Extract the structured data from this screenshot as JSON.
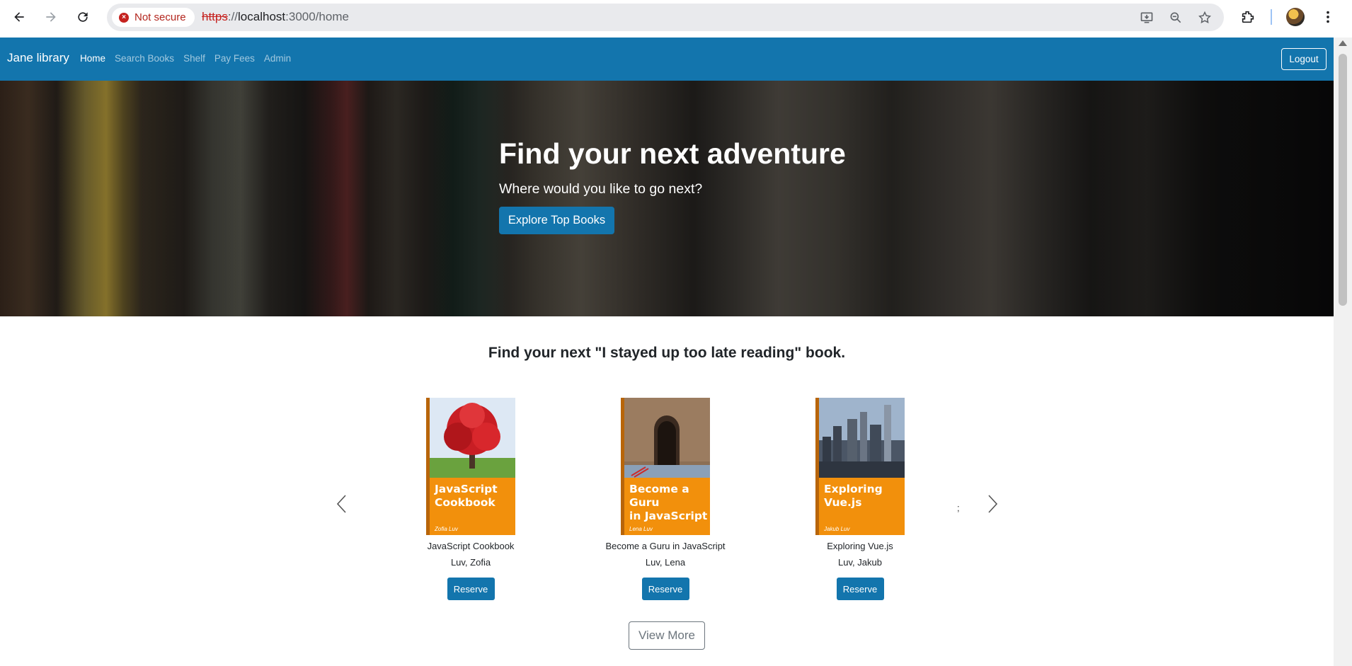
{
  "browser": {
    "security_label": "Not secure",
    "url_scheme": "https",
    "url_sep": "://",
    "url_host": "localhost",
    "url_rest": ":3000/home"
  },
  "nav": {
    "brand": "Jane library",
    "links": [
      "Home",
      "Search Books",
      "Shelf",
      "Pay Fees",
      "Admin"
    ],
    "active": "Home",
    "logout": "Logout"
  },
  "hero": {
    "title": "Find your next adventure",
    "subtitle": "Where would you like to go next?",
    "button": "Explore Top Books"
  },
  "books_section": {
    "title": "Find your next \"I stayed up too late reading\" book.",
    "carousel_indicator": ";",
    "view_more": "View More",
    "books": [
      {
        "cover_title_line1": "JavaScript",
        "cover_title_line2": "Cookbook",
        "cover_author": "Zofia Luv",
        "title": "JavaScript Cookbook",
        "author": "Luv, Zofia",
        "reserve": "Reserve"
      },
      {
        "cover_title_line1": "Become a Guru",
        "cover_title_line2": "in JavaScript",
        "cover_author": "Lena Luv",
        "title": "Become a Guru in JavaScript",
        "author": "Luv, Lena",
        "reserve": "Reserve"
      },
      {
        "cover_title_line1": "Exploring",
        "cover_title_line2": "Vue.js",
        "cover_author": "Jakub Luv",
        "title": "Exploring Vue.js",
        "author": "Luv, Jakub",
        "reserve": "Reserve"
      }
    ]
  },
  "colors": {
    "primary": "#1375ad",
    "cover_orange": "#f2900c"
  }
}
